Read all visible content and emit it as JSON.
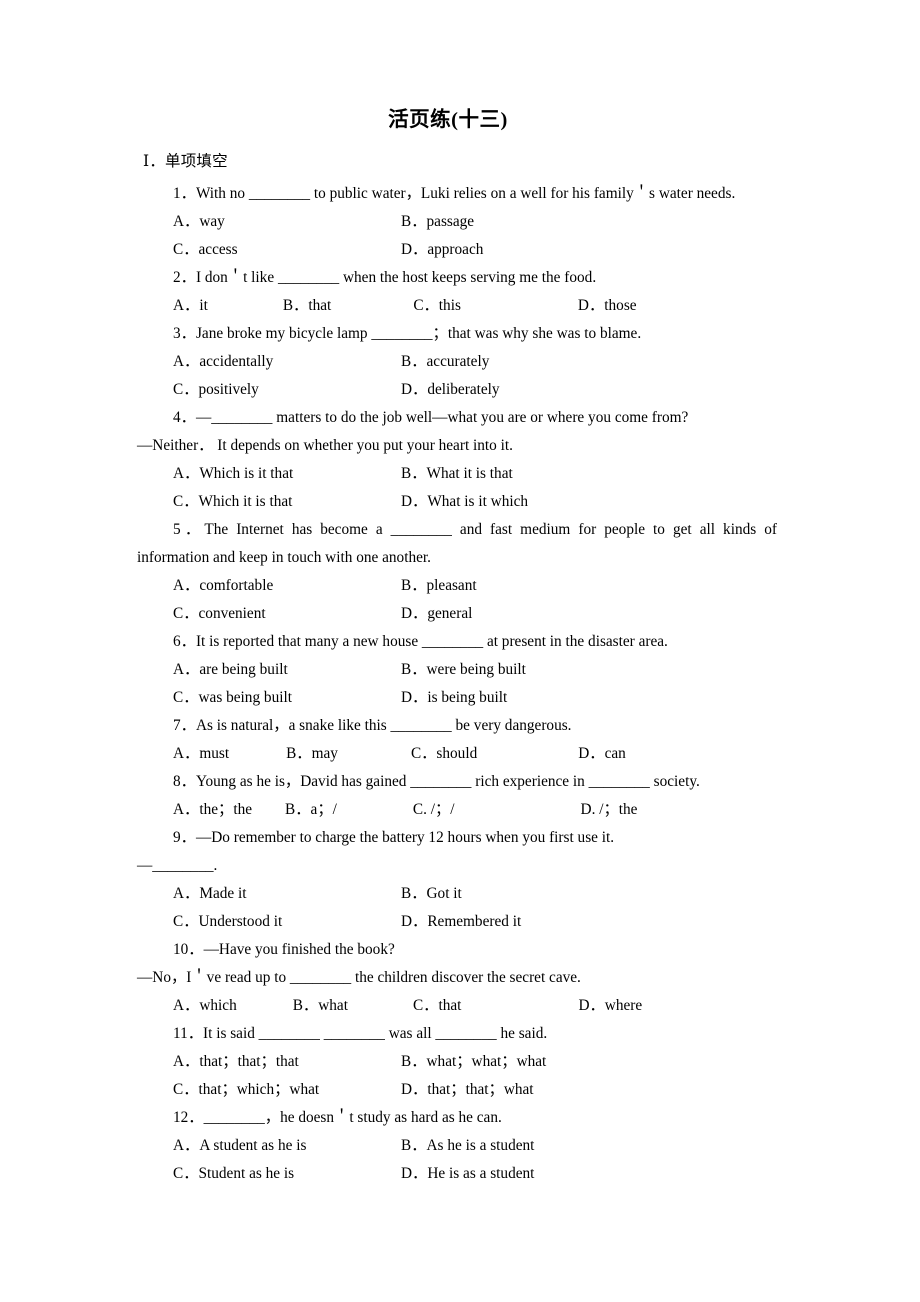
{
  "document": {
    "title": "活页练(十三)",
    "section_heading": "Ⅰ．单项填空"
  },
  "questions": [
    {
      "number": "1",
      "stem": "1．With no ________ to public water，Luki relies on a well for his family＇s water needs.",
      "layout": "two-column",
      "options": [
        {
          "label": "A．way"
        },
        {
          "label": "B．passage"
        },
        {
          "label": "C．access"
        },
        {
          "label": "D．approach"
        }
      ]
    },
    {
      "number": "2",
      "stem": "2．I don＇t like ________ when the host keeps serving me the food.",
      "layout": "four-across",
      "options": [
        {
          "label": "A．it"
        },
        {
          "label": "B．that"
        },
        {
          "label": "C．this"
        },
        {
          "label": "D．those"
        }
      ]
    },
    {
      "number": "3",
      "stem": "3．Jane broke my bicycle lamp ________；that was why she was to blame.",
      "layout": "two-column",
      "options": [
        {
          "label": "A．accidentally"
        },
        {
          "label": "B．accurately"
        },
        {
          "label": "C．positively"
        },
        {
          "label": "D．deliberately"
        }
      ]
    },
    {
      "number": "4",
      "stem": "4．—________ matters to do the job well—what you are or where you come from?",
      "stem_second_line": "—Neither． It depends on whether you put your heart into it.",
      "layout": "two-column",
      "options": [
        {
          "label": "A．Which is it that"
        },
        {
          "label": "B．What it is that"
        },
        {
          "label": "C．Which it is that"
        },
        {
          "label": "D．What is it which"
        }
      ]
    },
    {
      "number": "5",
      "stem": "5．The Internet has become a ________ and fast medium for people to get all kinds of information and keep in touch with one another.",
      "layout": "two-column",
      "justified": true,
      "options": [
        {
          "label": "A．comfortable"
        },
        {
          "label": "B．pleasant"
        },
        {
          "label": "C．convenient"
        },
        {
          "label": "D．general"
        }
      ]
    },
    {
      "number": "6",
      "stem": "6．It is reported that many a new house ________ at present in the disaster area.",
      "layout": "two-column",
      "options": [
        {
          "label": "A．are being built"
        },
        {
          "label": "B．were being built"
        },
        {
          "label": "C．was being built"
        },
        {
          "label": "D．is being built"
        }
      ]
    },
    {
      "number": "7",
      "stem": "7．As is natural，a snake like this ________ be very dangerous.",
      "layout": "four-across",
      "options": [
        {
          "label": "A．must"
        },
        {
          "label": "B．may"
        },
        {
          "label": "C．should"
        },
        {
          "label": "D．can"
        }
      ]
    },
    {
      "number": "8",
      "stem": "8．Young as he is，David has gained ________ rich experience in ________ society.",
      "layout": "four-across",
      "options": [
        {
          "label": "A．the；the"
        },
        {
          "label": "B．a；/"
        },
        {
          "label": "C. /；/"
        },
        {
          "label": "D. /；the"
        }
      ]
    },
    {
      "number": "9",
      "stem": "9．—Do remember to charge the battery 12 hours when you first use it.",
      "stem_second_line": "—________.",
      "layout": "two-column",
      "options": [
        {
          "label": "A．Made it"
        },
        {
          "label": "B．Got it"
        },
        {
          "label": "C．Understood it"
        },
        {
          "label": "D．Remembered it"
        }
      ]
    },
    {
      "number": "10",
      "stem": "10．—Have you finished the book?",
      "stem_second_line": "—No，I＇ve read up to ________ the children discover the secret cave.",
      "layout": "four-across",
      "options": [
        {
          "label": "A．which"
        },
        {
          "label": "B．what"
        },
        {
          "label": "C．that"
        },
        {
          "label": "D．where"
        }
      ]
    },
    {
      "number": "11",
      "stem": "11．It is said ________ ________ was all ________ he said.",
      "layout": "two-column",
      "options": [
        {
          "label": "A．that；that；that"
        },
        {
          "label": "B．what；what；what"
        },
        {
          "label": "C．that；which；what"
        },
        {
          "label": "D．that；that；what"
        }
      ]
    },
    {
      "number": "12",
      "stem": "12．________，he doesn＇t study as hard as he can.",
      "layout": "two-column",
      "options": [
        {
          "label": "A．A student as he is"
        },
        {
          "label": "B．As he is a student"
        },
        {
          "label": "C．Student as he is"
        },
        {
          "label": "D．He is as a student"
        }
      ]
    }
  ]
}
